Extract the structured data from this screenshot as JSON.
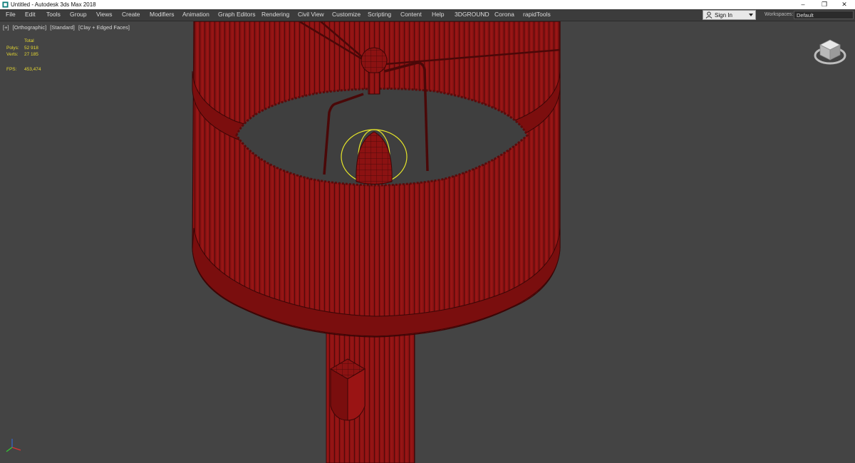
{
  "window": {
    "title": "Untitled - Autodesk 3ds Max 2018"
  },
  "window_controls": {
    "minimize": "–",
    "maximize": "❐",
    "close": "✕"
  },
  "menu": [
    "File",
    "Edit",
    "Tools",
    "Group",
    "Views",
    "Create",
    "Modifiers",
    "Animation",
    "Graph Editors",
    "Rendering",
    "Civil View",
    "Customize",
    "Scripting",
    "Content",
    "Help",
    "3DGROUND",
    "Corona",
    "rapidTools"
  ],
  "account": {
    "sign_in": "Sign In"
  },
  "workspaces": {
    "label": "Workspaces:",
    "value": "Default"
  },
  "viewport": {
    "labels": [
      "[+]",
      "[Orthographic]",
      "[Standard]",
      "[Clay + Edged Faces]"
    ],
    "stats": {
      "total_label": "Total",
      "polys_label": "Polys:",
      "polys_value": "52 918",
      "verts_label": "Verts:",
      "verts_value": "27 185",
      "fps_label": "FPS:",
      "fps_value": "453,474"
    }
  },
  "colors": {
    "model": "#8a1010",
    "wire": "#3a0606",
    "selection": "#e5e52a",
    "viewport_bg": "#444444",
    "stats_text": "#e6d830"
  },
  "icons": [
    "app-icon",
    "user-icon",
    "dropdown-caret-icon",
    "navigation-cube-icon",
    "axis-tripod-icon"
  ]
}
